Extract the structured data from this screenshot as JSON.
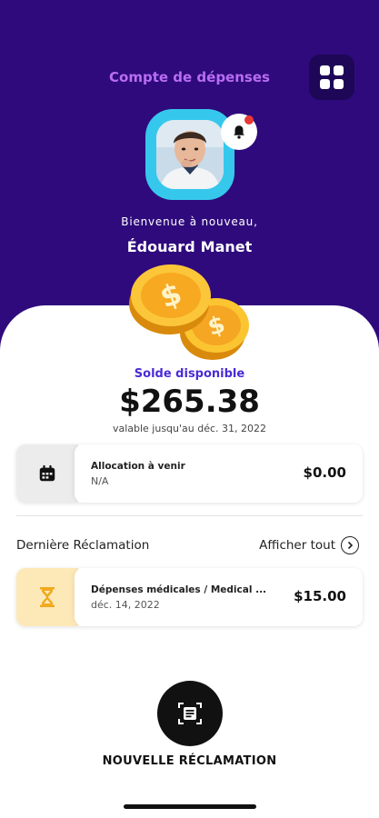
{
  "header": {
    "title": "Compte de dépenses"
  },
  "icons": {
    "menu": "grid-icon",
    "notifications": "bell-icon",
    "calendar": "calendar-icon",
    "claim": "hourglass-icon",
    "see_all": "chevron-right-circle-icon",
    "new_claim": "receipt-scan-icon"
  },
  "colors": {
    "hero_bg": "#2f0a7c",
    "accent_title": "#b86df2",
    "avatar_ring": "#36c8ec",
    "balance_label": "#4a2bd6",
    "notification_dot": "#e53935",
    "allocation_tile": "#ececec",
    "claim_tile": "#fde9b8"
  },
  "profile": {
    "welcome": "Bienvenue à nouveau,",
    "first_name": "Édouard",
    "last_name": "Manet"
  },
  "balance": {
    "label": "Solde disponible",
    "amount": "$265.38",
    "valid_until": "valable jusqu'au déc. 31, 2022"
  },
  "allocation": {
    "title": "Allocation à venir",
    "subtitle": "N/A",
    "amount": "$0.00"
  },
  "claims": {
    "section_title": "Dernière Réclamation",
    "see_all_label": "Afficher tout",
    "latest": {
      "title": "Dépenses médicales / Medical ...",
      "date": "déc. 14, 2022",
      "amount": "$15.00"
    }
  },
  "new_claim": {
    "label": "NOUVELLE RÉCLAMATION"
  }
}
